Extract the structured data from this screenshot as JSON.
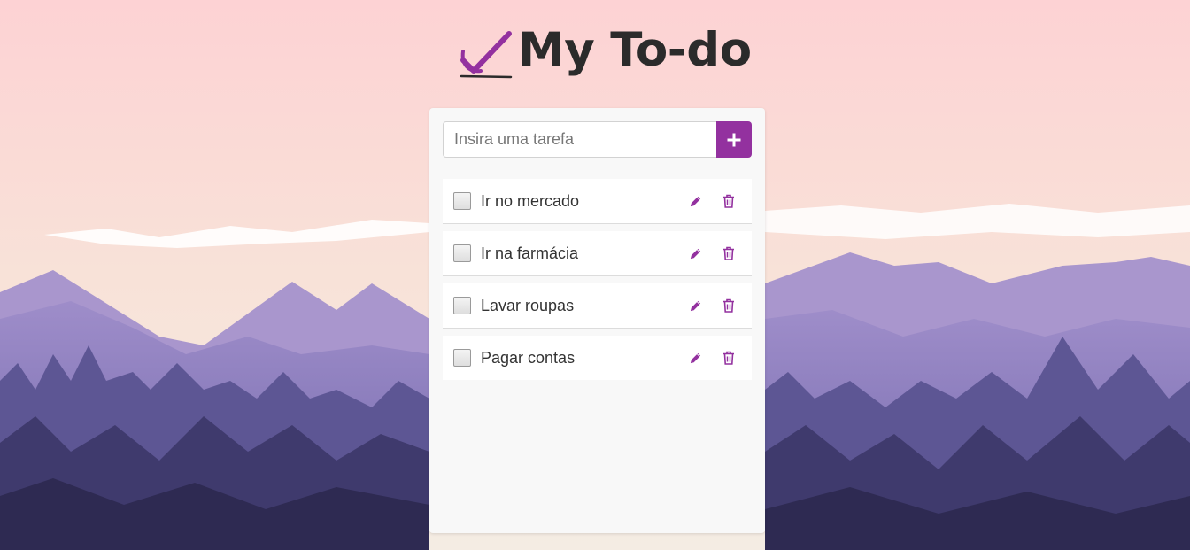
{
  "app": {
    "title": "My To-do"
  },
  "form": {
    "placeholder": "Insira uma tarefa",
    "value": ""
  },
  "tasks": [
    {
      "label": "Ir no mercado",
      "done": false
    },
    {
      "label": "Ir na farmácia",
      "done": false
    },
    {
      "label": "Lavar roupas",
      "done": false
    },
    {
      "label": "Pagar contas",
      "done": false
    }
  ],
  "icons": {
    "logo": "check-mark-icon",
    "add": "plus-icon",
    "edit": "pencil-icon",
    "delete": "trash-icon"
  },
  "colors": {
    "accent": "#93319f",
    "title": "#2b2b2b",
    "card": "#f8f8f8",
    "sky_top": "#fdd4d4",
    "sky_bottom": "#f8e3d2",
    "mountains": "#8f7bbf"
  }
}
